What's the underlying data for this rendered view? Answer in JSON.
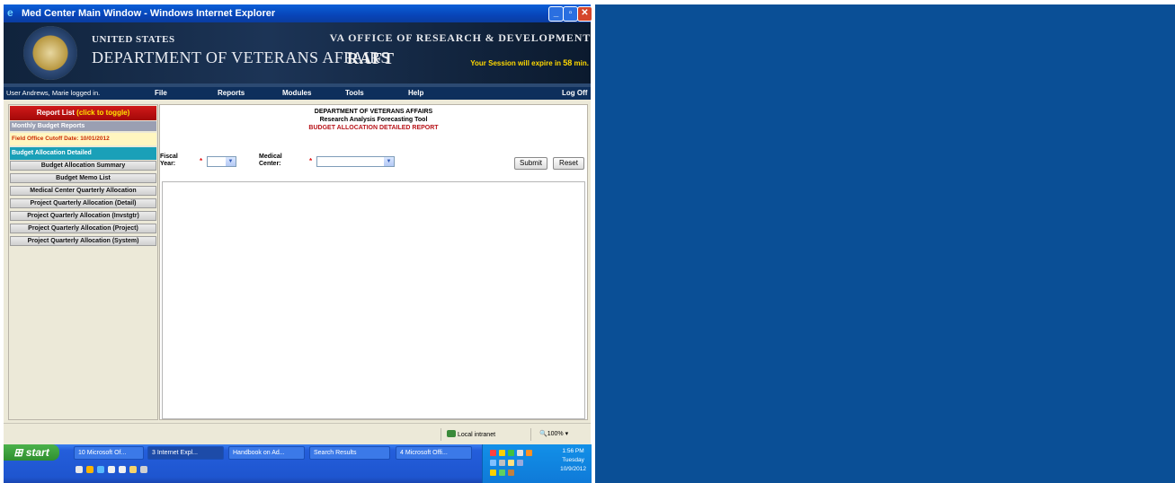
{
  "window": {
    "title": "Med Center Main Window - Windows Internet Explorer"
  },
  "banner": {
    "united_states": "UNITED STATES",
    "department": "DEPARTMENT OF VETERANS AFFAIRS",
    "office": "VA OFFICE OF RESEARCH & DEVELOPMENT",
    "app": "RAFT",
    "session_prefix": "Your Session will expire in",
    "session_minutes": "58",
    "session_suffix": "min."
  },
  "menu": {
    "user": "User Andrews, Marie logged in.",
    "items": [
      "File",
      "Reports",
      "Modules",
      "Tools",
      "Help"
    ],
    "logoff": "Log Off"
  },
  "sidebar": {
    "report_list": "Report List",
    "toggle": "(click to toggle)",
    "monthly": "Monthly Budget Reports",
    "cutoff": "Field Office Cutoff Date: 10/01/2012",
    "selected": "Budget Allocation Detailed",
    "items": [
      "Budget Allocation Summary",
      "Budget Memo List",
      "Medical Center Quarterly Allocation",
      "Project Quarterly Allocation (Detail)",
      "Project Quarterly Allocation (Invstgtr)",
      "Project Quarterly Allocation (Project)",
      "Project Quarterly Allocation (System)"
    ]
  },
  "report": {
    "line1": "DEPARTMENT OF VETERANS AFFAIRS",
    "line2": "Research Analysis Forecasting Tool",
    "line3": "BUDGET ALLOCATION DETAILED REPORT",
    "fiscal_label_1": "Fiscal",
    "fiscal_label_2": "Year:",
    "medical_label_1": "Medical",
    "medical_label_2": "Center:",
    "required": "*",
    "fiscal_value": "",
    "medical_value": "",
    "submit": "Submit",
    "reset": "Reset"
  },
  "status": {
    "zone": "Local intranet",
    "zoom": "100%"
  },
  "taskbar": {
    "start": "start",
    "buttons": [
      "10 Microsoft Of...",
      "3 Internet Expl...",
      "Handbook on Ad...",
      "Search Results",
      "4 Microsoft Offi..."
    ],
    "time": "1:56 PM",
    "day": "Tuesday",
    "date": "10/9/2012"
  },
  "colors": {
    "desktop": "#0a4f96",
    "menu_bar": "#0e2f5c",
    "report_list": "#c01010",
    "selected": "#1aa0b8"
  }
}
